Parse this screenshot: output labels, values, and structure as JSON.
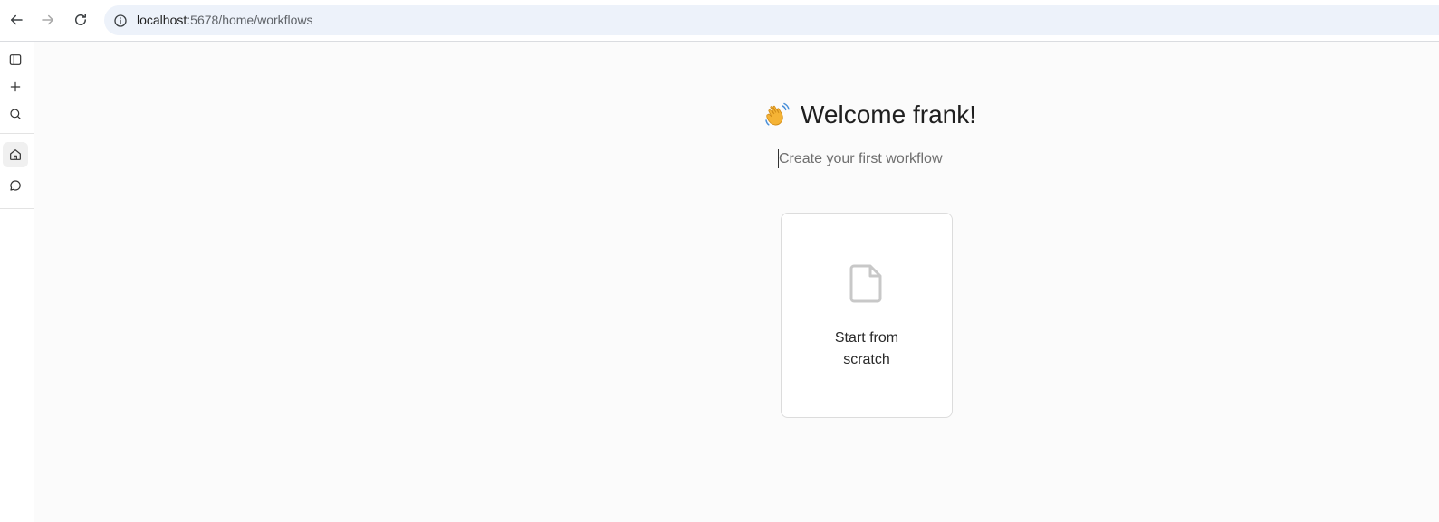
{
  "browser": {
    "url_host": "localhost",
    "url_rest": ":5678/home/workflows"
  },
  "sidebar": {
    "items": [
      {
        "name": "toggle-sidebar",
        "icon": "panel-left-icon"
      },
      {
        "name": "add",
        "icon": "plus-icon"
      },
      {
        "name": "search",
        "icon": "search-icon"
      },
      {
        "name": "home",
        "icon": "home-icon",
        "active": true
      },
      {
        "name": "chat",
        "icon": "chat-bubble-icon"
      }
    ]
  },
  "main": {
    "welcome_emoji": "waving-hand-icon",
    "welcome_title": "Welcome frank!",
    "subtitle": "Create your first workflow",
    "card": {
      "icon": "file-icon",
      "label_line1": "Start from",
      "label_line2": "scratch"
    }
  },
  "colors": {
    "canvas_bg": "#fbfbfb",
    "address_bar_bg": "#edf2fa",
    "card_border": "#dcdcdc",
    "icon_gray": "#c8c8c8"
  }
}
